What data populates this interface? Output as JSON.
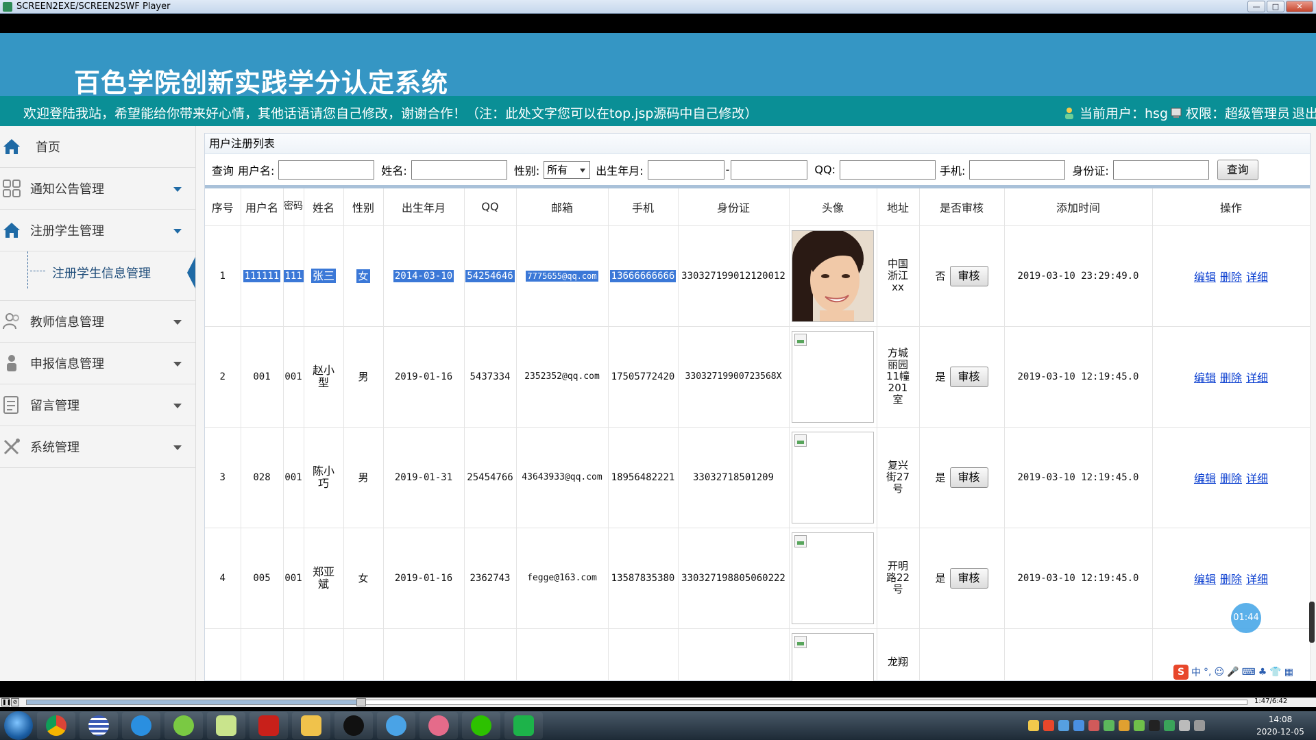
{
  "window": {
    "title": "SCREEN2EXE/SCREEN2SWF Player",
    "buttons": [
      "—",
      "□",
      "✕"
    ]
  },
  "header": {
    "system_title": "百色学院创新实践学分认定系统",
    "welcome_text": "欢迎登陆我站，希望能给你带来好心情，其他话语请您自己修改，谢谢合作！（注：此处文字您可以在top.jsp源码中自己修改）",
    "current_user_label": "当前用户：hsg",
    "permission_label": "权限：超级管理员",
    "logout_label": "退出"
  },
  "sidebar": {
    "items": [
      {
        "label": "首页",
        "icon": "home-icon"
      },
      {
        "label": "通知公告管理",
        "icon": "grid-icon"
      },
      {
        "label": "注册学生管理",
        "icon": "home-icon"
      },
      {
        "label": "教师信息管理",
        "icon": "people-icon"
      },
      {
        "label": "申报信息管理",
        "icon": "person-icon"
      },
      {
        "label": "留言管理",
        "icon": "form-icon"
      },
      {
        "label": "系统管理",
        "icon": "tools-icon"
      }
    ],
    "sub_item": "注册学生信息管理"
  },
  "panel": {
    "title": "用户注册列表"
  },
  "search": {
    "query_label": "查询",
    "username_label": "用户名:",
    "name_label": "姓名:",
    "gender_label": "性别:",
    "gender_value": "所有",
    "birth_label": "出生年月:",
    "qq_label": "QQ:",
    "phone_label": "手机:",
    "idcard_label": "身份证:",
    "submit": "查询"
  },
  "table": {
    "headers": [
      "序号",
      "用户名",
      "密码",
      "姓名",
      "性别",
      "出生年月",
      "QQ",
      "邮箱",
      "手机",
      "身份证",
      "头像",
      "地址",
      "是否审核",
      "添加时间",
      "操作"
    ],
    "rows": [
      {
        "no": "1",
        "username": "111111",
        "password": "111",
        "name": "张三",
        "gender": "女",
        "birth": "2014-03-10",
        "qq": "54254646",
        "email": "7775655@qq.com",
        "phone": "13666666666",
        "idcard": "330327199012120012",
        "address": "中国浙江xx",
        "audited": "否",
        "added": "2019-03-10 23:29:49.0"
      },
      {
        "no": "2",
        "username": "001",
        "password": "001",
        "name": "赵小型",
        "gender": "男",
        "birth": "2019-01-16",
        "qq": "5437334",
        "email": "2352352@qq.com",
        "phone": "17505772420",
        "idcard": "33032719900723568X",
        "address": "方城丽园11幢201室",
        "audited": "是",
        "added": "2019-03-10 12:19:45.0"
      },
      {
        "no": "3",
        "username": "028",
        "password": "001",
        "name": "陈小巧",
        "gender": "男",
        "birth": "2019-01-31",
        "qq": "25454766",
        "email": "43643933@qq.com",
        "phone": "18956482221",
        "idcard": "33032718501209",
        "address": "复兴街27号",
        "audited": "是",
        "added": "2019-03-10 12:19:45.0"
      },
      {
        "no": "4",
        "username": "005",
        "password": "001",
        "name": "郑亚斌",
        "gender": "女",
        "birth": "2019-01-16",
        "qq": "2362743",
        "email": "fegge@163.com",
        "phone": "13587835380",
        "idcard": "330327198805060222",
        "address": "开明路22号",
        "audited": "是",
        "added": "2019-03-10 12:19:45.0"
      },
      {
        "no": "",
        "username": "",
        "password": "",
        "name": "",
        "gender": "",
        "birth": "",
        "qq": "",
        "email": "",
        "phone": "",
        "idcard": "",
        "address": "龙翔",
        "audited": "",
        "added": ""
      }
    ],
    "audit_button": "审核",
    "ops": {
      "edit": "编辑",
      "delete": "删除",
      "detail": "详细"
    }
  },
  "overlay": {
    "timer": "01:44",
    "ime": [
      "中",
      "°,",
      "☺",
      "🎤",
      "⌨",
      "♣",
      "👕",
      "▦"
    ]
  },
  "player": {
    "time": "1:47/6:42"
  },
  "taskbar": {
    "time": "14:08",
    "date": "2020-12-05"
  },
  "colors": {
    "header_bg": "#3596c4",
    "welcome_bg": "#0a8f96",
    "link": "#0b3fd0",
    "selection": "#3b78d7"
  }
}
